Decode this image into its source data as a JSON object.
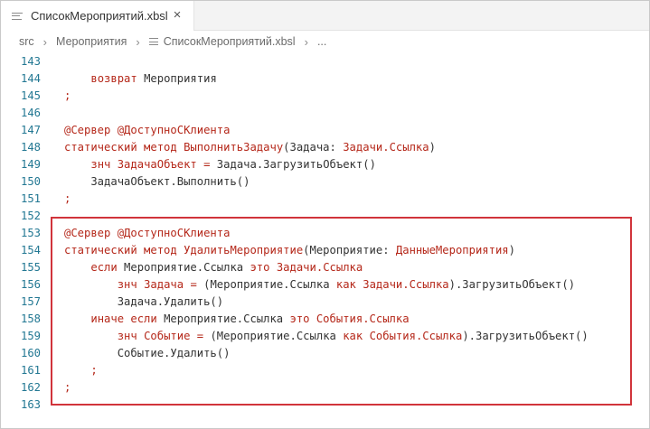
{
  "tab": {
    "label": "СписокМероприятий.xbsl",
    "close": "×"
  },
  "breadcrumb": {
    "items": [
      "src",
      "Мероприятия",
      "СписокМероприятий.xbsl"
    ],
    "ellipsis": "..."
  },
  "lines": [
    {
      "num": "143",
      "parts": []
    },
    {
      "num": "144",
      "parts": [
        {
          "t": "    "
        },
        {
          "t": "возврат",
          "c": "kw"
        },
        {
          "t": " Мероприятия"
        }
      ]
    },
    {
      "num": "145",
      "parts": [
        {
          "t": ";",
          "c": "pn"
        }
      ]
    },
    {
      "num": "146",
      "parts": []
    },
    {
      "num": "147",
      "parts": [
        {
          "t": "@Сервер @ДоступноСКлиента",
          "c": "ann"
        }
      ]
    },
    {
      "num": "148",
      "parts": [
        {
          "t": "статический метод",
          "c": "kw"
        },
        {
          "t": " "
        },
        {
          "t": "ВыполнитьЗадачу",
          "c": "fn"
        },
        {
          "t": "(Задача: "
        },
        {
          "t": "Задачи.Ссылка",
          "c": "ty"
        },
        {
          "t": ")"
        }
      ]
    },
    {
      "num": "149",
      "parts": [
        {
          "t": "    "
        },
        {
          "t": "знч",
          "c": "kw"
        },
        {
          "t": " "
        },
        {
          "t": "ЗадачаОбъект",
          "c": "fn"
        },
        {
          "t": " "
        },
        {
          "t": "=",
          "c": "pn"
        },
        {
          "t": " Задача.ЗагрузитьОбъект()"
        }
      ]
    },
    {
      "num": "150",
      "parts": [
        {
          "t": "    ЗадачаОбъект.Выполнить()"
        }
      ]
    },
    {
      "num": "151",
      "parts": [
        {
          "t": ";",
          "c": "pn"
        }
      ]
    },
    {
      "num": "152",
      "parts": []
    },
    {
      "num": "153",
      "parts": [
        {
          "t": "@Сервер @ДоступноСКлиента",
          "c": "ann"
        }
      ]
    },
    {
      "num": "154",
      "parts": [
        {
          "t": "статический метод",
          "c": "kw"
        },
        {
          "t": " "
        },
        {
          "t": "УдалитьМероприятие",
          "c": "fn"
        },
        {
          "t": "(Мероприятие: "
        },
        {
          "t": "ДанныеМероприятия",
          "c": "ty"
        },
        {
          "t": ")"
        }
      ]
    },
    {
      "num": "155",
      "parts": [
        {
          "t": "    "
        },
        {
          "t": "если",
          "c": "kw"
        },
        {
          "t": " Мероприятие.Ссылка "
        },
        {
          "t": "это",
          "c": "kw"
        },
        {
          "t": " "
        },
        {
          "t": "Задачи.Ссылка",
          "c": "ty"
        }
      ]
    },
    {
      "num": "156",
      "parts": [
        {
          "t": "        "
        },
        {
          "t": "знч",
          "c": "kw"
        },
        {
          "t": " "
        },
        {
          "t": "Задача",
          "c": "fn"
        },
        {
          "t": " "
        },
        {
          "t": "=",
          "c": "pn"
        },
        {
          "t": " (Мероприятие.Ссылка "
        },
        {
          "t": "как",
          "c": "kw"
        },
        {
          "t": " "
        },
        {
          "t": "Задачи.Ссылка",
          "c": "ty"
        },
        {
          "t": ").ЗагрузитьОбъект()"
        }
      ]
    },
    {
      "num": "157",
      "parts": [
        {
          "t": "        Задача.Удалить()"
        }
      ]
    },
    {
      "num": "158",
      "parts": [
        {
          "t": "    "
        },
        {
          "t": "иначе если",
          "c": "kw"
        },
        {
          "t": " Мероприятие.Ссылка "
        },
        {
          "t": "это",
          "c": "kw"
        },
        {
          "t": " "
        },
        {
          "t": "События.Ссылка",
          "c": "ty"
        }
      ]
    },
    {
      "num": "159",
      "parts": [
        {
          "t": "        "
        },
        {
          "t": "знч",
          "c": "kw"
        },
        {
          "t": " "
        },
        {
          "t": "Событие",
          "c": "fn"
        },
        {
          "t": " "
        },
        {
          "t": "=",
          "c": "pn"
        },
        {
          "t": " (Мероприятие.Ссылка "
        },
        {
          "t": "как",
          "c": "kw"
        },
        {
          "t": " "
        },
        {
          "t": "События.Ссылка",
          "c": "ty"
        },
        {
          "t": ").ЗагрузитьОбъект()"
        }
      ]
    },
    {
      "num": "160",
      "parts": [
        {
          "t": "        Событие.Удалить()"
        }
      ]
    },
    {
      "num": "161",
      "parts": [
        {
          "t": "    "
        },
        {
          "t": ";",
          "c": "pn"
        }
      ]
    },
    {
      "num": "162",
      "parts": [
        {
          "t": ";",
          "c": "pn"
        }
      ]
    },
    {
      "num": "163",
      "parts": []
    }
  ],
  "colors": {
    "line_number": "#237893",
    "keyword": "#b5281a",
    "highlight_box": "#d1343b"
  }
}
